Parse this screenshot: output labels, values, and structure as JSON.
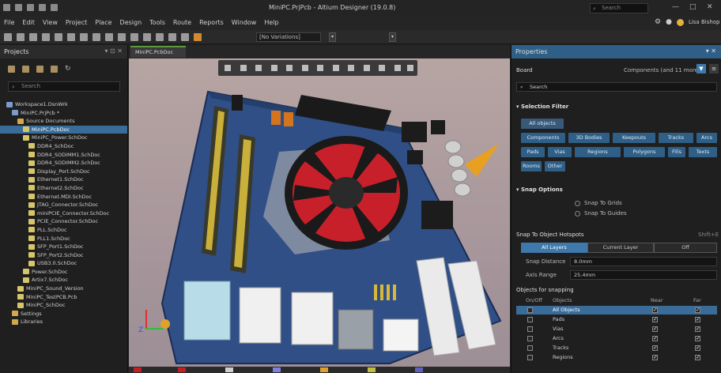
{
  "window": {
    "title": "MiniPC.PrjPcb - Altium Designer (19.0.8)",
    "search_placeholder": "Search",
    "search_icon": "search-icon",
    "window_controls": [
      "—",
      "□",
      "✕"
    ]
  },
  "menu": {
    "items": [
      "File",
      "Edit",
      "View",
      "Project",
      "Place",
      "Design",
      "Tools",
      "Route",
      "Reports",
      "Window",
      "Help"
    ],
    "user_label": "Lisa Bishop"
  },
  "toolbar": {
    "variant_combo": "[No Variations]"
  },
  "projects_panel": {
    "title": "Projects",
    "search_placeholder": "Search",
    "tree": [
      {
        "label": "Workspace1.DsnWrk",
        "indent": 0,
        "kind": "prj",
        "selected": false
      },
      {
        "label": "MiniPC.PrjPcb *",
        "indent": 1,
        "kind": "prj",
        "selected": false
      },
      {
        "label": "Source Documents",
        "indent": 2,
        "kind": "fld",
        "selected": false
      },
      {
        "label": "MiniPC.PcbDoc",
        "indent": 3,
        "kind": "doc",
        "selected": true
      },
      {
        "label": "MiniPC_Power.SchDoc",
        "indent": 3,
        "kind": "doc",
        "selected": false
      },
      {
        "label": "DDR4_SchDoc",
        "indent": 4,
        "kind": "doc",
        "selected": false
      },
      {
        "label": "DDR4_SODIMM1.SchDoc",
        "indent": 4,
        "kind": "doc",
        "selected": false
      },
      {
        "label": "DDR4_SODIMM2.SchDoc",
        "indent": 4,
        "kind": "doc",
        "selected": false
      },
      {
        "label": "Display_Port.SchDoc",
        "indent": 4,
        "kind": "doc",
        "selected": false
      },
      {
        "label": "Ethernet1.SchDoc",
        "indent": 4,
        "kind": "doc",
        "selected": false
      },
      {
        "label": "Ethernet2.SchDoc",
        "indent": 4,
        "kind": "doc",
        "selected": false
      },
      {
        "label": "Ethernet.MDI.SchDoc",
        "indent": 4,
        "kind": "doc",
        "selected": false
      },
      {
        "label": "JTAG_Connector.SchDoc",
        "indent": 4,
        "kind": "doc",
        "selected": false
      },
      {
        "label": "miniPCIE_Connector.SchDoc",
        "indent": 4,
        "kind": "doc",
        "selected": false
      },
      {
        "label": "PCIE_Connector.SchDoc",
        "indent": 4,
        "kind": "doc",
        "selected": false
      },
      {
        "label": "PLL.SchDoc",
        "indent": 4,
        "kind": "doc",
        "selected": false
      },
      {
        "label": "PLL1.SchDoc",
        "indent": 4,
        "kind": "doc",
        "selected": false
      },
      {
        "label": "SFP_Port1.SchDoc",
        "indent": 4,
        "kind": "doc",
        "selected": false
      },
      {
        "label": "SFP_Port2.SchDoc",
        "indent": 4,
        "kind": "doc",
        "selected": false
      },
      {
        "label": "USB3.0.SchDoc",
        "indent": 4,
        "kind": "doc",
        "selected": false
      },
      {
        "label": "Power.SchDoc",
        "indent": 3,
        "kind": "doc",
        "selected": false
      },
      {
        "label": "Artix7.SchDoc",
        "indent": 3,
        "kind": "doc",
        "selected": false
      },
      {
        "label": "MiniPC_Sound_Version",
        "indent": 2,
        "kind": "doc",
        "selected": false
      },
      {
        "label": "MiniPC_TestPCB.Pcb",
        "indent": 2,
        "kind": "doc",
        "selected": false
      },
      {
        "label": "MiniPC_SchDoc",
        "indent": 2,
        "kind": "doc",
        "selected": false
      },
      {
        "label": "Settings",
        "indent": 1,
        "kind": "fld",
        "selected": false
      },
      {
        "label": "Libraries",
        "indent": 1,
        "kind": "fld",
        "selected": false
      }
    ]
  },
  "document_tab": {
    "label": "MiniPC.PcbDoc"
  },
  "properties_panel": {
    "title": "Properties",
    "board_label": "Board",
    "components_label": "Components (and 11 more)",
    "search_placeholder": "Search",
    "selection_filter": {
      "title": "Selection Filter",
      "all_objects": "All objects",
      "chips": [
        "Components",
        "3D Bodies",
        "Keepouts",
        "Tracks",
        "Arcs",
        "Pads",
        "Vias",
        "Regions",
        "Polygons",
        "Fills",
        "Texts",
        "Rooms",
        "Other"
      ]
    },
    "snap_options": {
      "title": "Snap Options",
      "options": [
        "Snap To Grids",
        "Snap To Guides"
      ]
    },
    "snap_hotspots": {
      "title": "Snap To Object Hotspots",
      "shortcut": "Shift+E",
      "segments": [
        "All Layers",
        "Current Layer",
        "Off"
      ],
      "snap_distance_label": "Snap Distance",
      "snap_distance_value": "8.0mm",
      "axis_range_label": "Axis Range",
      "axis_range_value": "25.4mm"
    },
    "objects_for_snapping": {
      "title": "Objects for snapping",
      "columns": [
        "On/Off",
        "Objects",
        "Near",
        "Far"
      ],
      "rows": [
        {
          "name": "All Objects",
          "highlight": true
        },
        {
          "name": "Pads",
          "highlight": false
        },
        {
          "name": "Vias",
          "highlight": false
        },
        {
          "name": "Arcs",
          "highlight": false
        },
        {
          "name": "Tracks",
          "highlight": false
        },
        {
          "name": "Regions",
          "highlight": false
        }
      ]
    }
  },
  "colors": {
    "accent_blue": "#3a6c9a",
    "pcb_blue": "#2f4f86",
    "fan_red": "#c8202a",
    "tab_green": "#5b9a3b"
  }
}
